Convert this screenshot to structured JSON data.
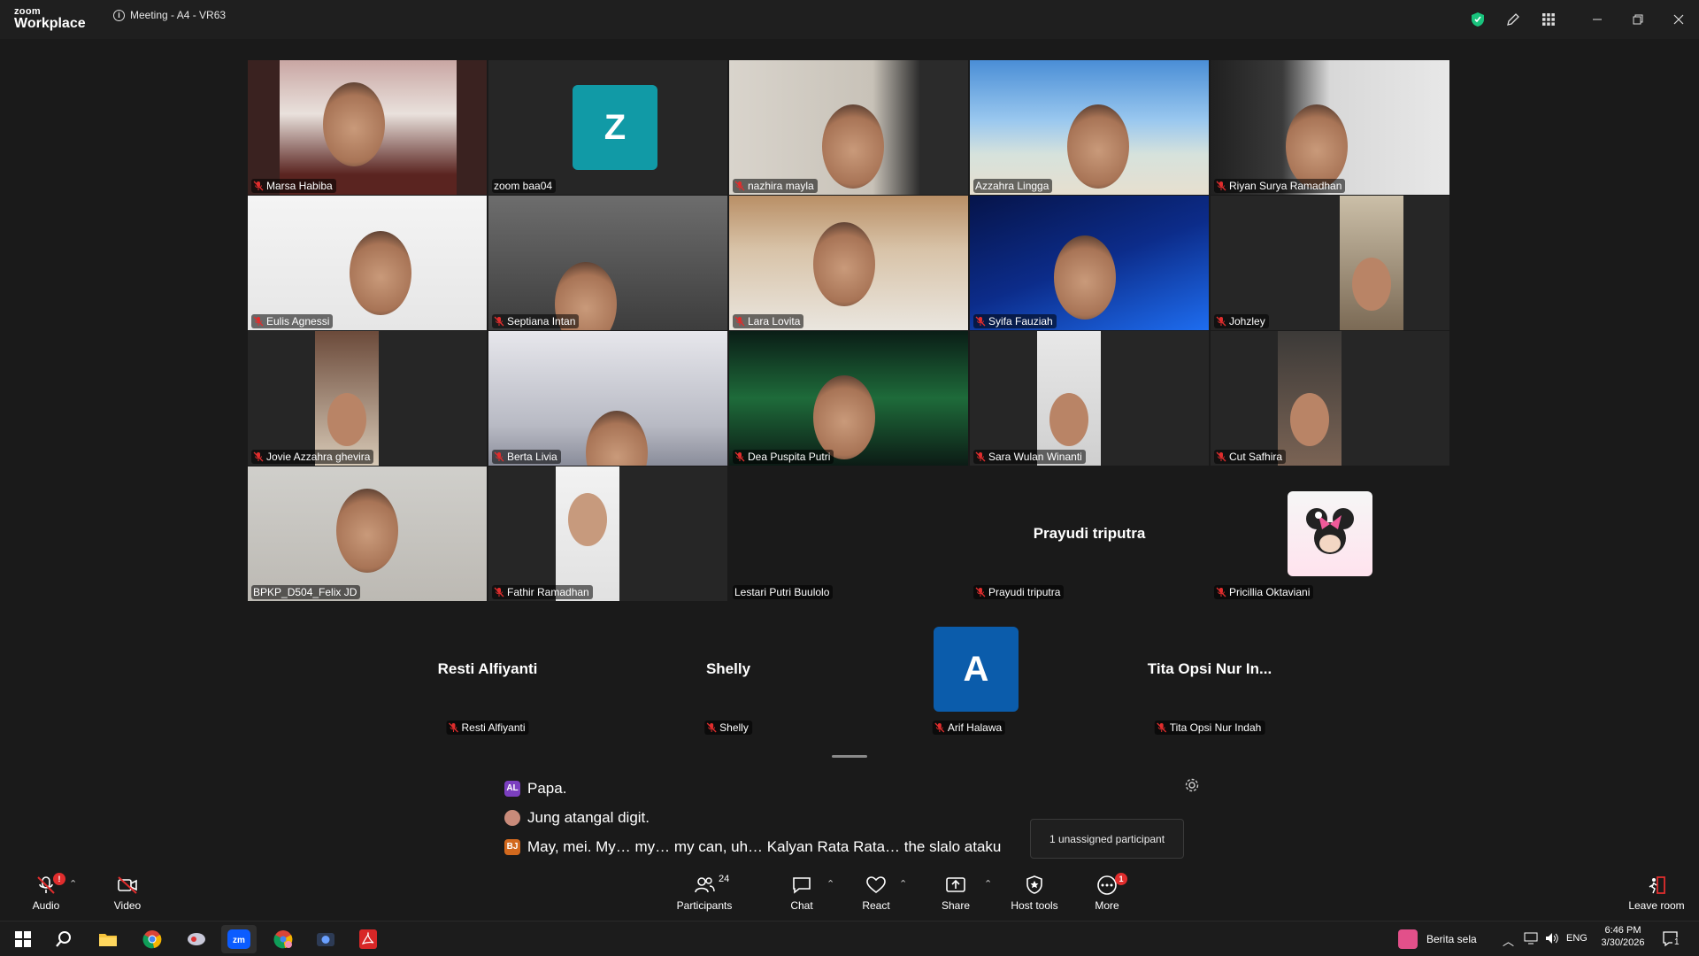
{
  "titlebar": {
    "logo_top": "zoom",
    "logo_bottom": "Workplace",
    "meeting_title": "Meeting - A4 - VR63"
  },
  "gallery": [
    {
      "name": "Marsa Habiba",
      "muted": true
    },
    {
      "name": "zoom baa04",
      "muted": false,
      "avatar_letter": "Z",
      "avatar_color": "#119aa6"
    },
    {
      "name": "nazhira mayla",
      "muted": true
    },
    {
      "name": "Azzahra Lingga",
      "muted": false
    },
    {
      "name": "Riyan Surya Ramadhan",
      "muted": true
    },
    {
      "name": "Eulis Agnessi",
      "muted": true
    },
    {
      "name": "Septiana Intan",
      "muted": true
    },
    {
      "name": "Lara Lovita",
      "muted": true
    },
    {
      "name": "Syifa Fauziah",
      "muted": true
    },
    {
      "name": "Johzley",
      "muted": true
    },
    {
      "name": "Jovie Azzahra ghevira",
      "muted": true
    },
    {
      "name": "Berta Livia",
      "muted": true
    },
    {
      "name": "Dea Puspita Putri",
      "muted": true
    },
    {
      "name": "Sara Wulan Winanti",
      "muted": true
    },
    {
      "name": "Cut Safhira",
      "muted": true
    },
    {
      "name": "BPKP_D504_Felix JD",
      "muted": false,
      "active_speaker": true
    },
    {
      "name": "Fathir Ramadhan",
      "muted": true
    },
    {
      "name": "Lestari Putri Buulolo",
      "muted": false
    },
    {
      "name": "Prayudi triputra",
      "muted": true,
      "display_name": "Prayudi triputra"
    },
    {
      "name": "Pricillia Oktaviani",
      "muted": true
    },
    {
      "name": "Resti Alfiyanti",
      "muted": true,
      "display_name": "Resti Alfiyanti"
    },
    {
      "name": "Shelly",
      "muted": true,
      "display_name": "Shelly"
    },
    {
      "name": "Arif Halawa",
      "muted": true,
      "avatar_letter": "A",
      "avatar_color": "#0b5cab"
    },
    {
      "name": "Tita Opsi Nur Indah",
      "muted": true,
      "display_name": "Tita Opsi Nur In..."
    }
  ],
  "captions": [
    {
      "initials": "AL",
      "color": "#7b3fbf",
      "text": "Papa."
    },
    {
      "initials": "",
      "color": "#c98b7a",
      "text": "Jung atangal digit."
    },
    {
      "initials": "BJ",
      "color": "#d2691e",
      "text": "May, mei. My… my… my can, uh… Kalyan Rata Rata… the slalo ataku"
    }
  ],
  "tooltip": "1 unassigned participant",
  "toolbar": {
    "audio": "Audio",
    "video": "Video",
    "participants": "Participants",
    "participants_count": "24",
    "chat": "Chat",
    "react": "React",
    "share": "Share",
    "host_tools": "Host tools",
    "more": "More",
    "more_badge": "1",
    "leave": "Leave room"
  },
  "taskbar": {
    "news": "Berita sela",
    "lang": "ENG",
    "time": "6:46 PM",
    "date": "3/30/2026",
    "notif_count": "1"
  },
  "colors": {
    "active_speaker": "#3dd68c",
    "mute_red": "#e02d2d",
    "shield_green": "#19c37d"
  }
}
